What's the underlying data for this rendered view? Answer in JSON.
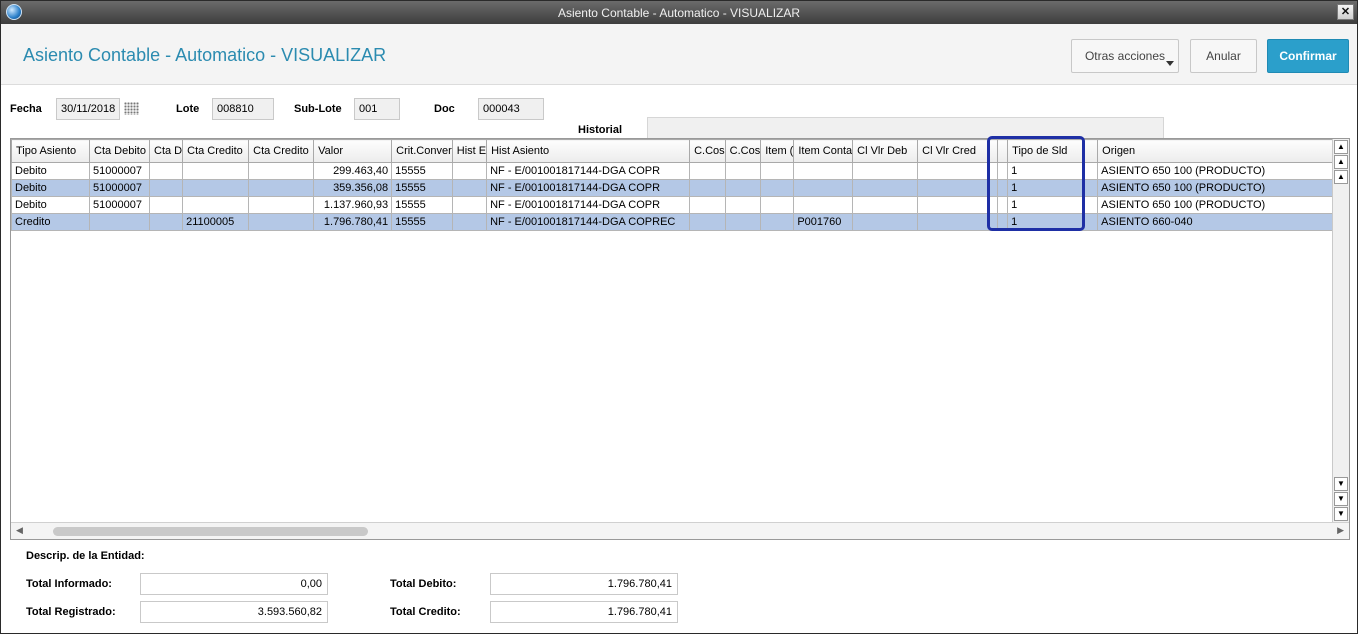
{
  "window": {
    "title": "Asiento Contable - Automatico - VISUALIZAR"
  },
  "header": {
    "page_title": "Asiento Contable - Automatico - VISUALIZAR",
    "otras_label": "Otras acciones",
    "anular_label": "Anular",
    "confirmar_label": "Confirmar"
  },
  "form": {
    "fecha_label": "Fecha",
    "fecha_value": "30/11/2018",
    "lote_label": "Lote",
    "lote_value": "008810",
    "sublote_label": "Sub-Lote",
    "sublote_value": "001",
    "doc_label": "Doc",
    "doc_value": "000043",
    "historial_label": "Historial"
  },
  "grid": {
    "columns": [
      "Tipo Asiento",
      "Cta Debito",
      "Cta D",
      "Cta Credito",
      "Cta Credito",
      "Valor",
      "Crit.Conver",
      "Hist E",
      "Hist Asiento",
      "C.Cos",
      "C.Cos",
      "Item (",
      "Item Conta",
      "Cl Vlr Deb",
      "Cl Vlr Cred",
      "",
      "Tipo de Sld",
      "Origen"
    ],
    "rows": [
      [
        "Debito",
        "51000007",
        "",
        "",
        "",
        "299.463,40",
        "15555",
        "",
        "NF - E/001001817144-DGA COPR",
        "",
        "",
        "",
        "",
        "",
        "",
        "",
        "1",
        "ASIENTO 650 100 (PRODUCTO)"
      ],
      [
        "Debito",
        "51000007",
        "",
        "",
        "",
        "359.356,08",
        "15555",
        "",
        "NF - E/001001817144-DGA COPR",
        "",
        "",
        "",
        "",
        "",
        "",
        "",
        "1",
        "ASIENTO 650 100 (PRODUCTO)"
      ],
      [
        "Debito",
        "51000007",
        "",
        "",
        "",
        "1.137.960,93",
        "15555",
        "",
        "NF - E/001001817144-DGA COPR",
        "",
        "",
        "",
        "",
        "",
        "",
        "",
        "1",
        "ASIENTO 650 100 (PRODUCTO)"
      ],
      [
        "Credito",
        "",
        "",
        "21100005",
        "",
        "1.796.780,41",
        "15555",
        "",
        "NF - E/001001817144-DGA COPREC",
        "",
        "",
        "",
        "P001760",
        "",
        "",
        "",
        "1",
        "ASIENTO 660-040"
      ]
    ],
    "selected_rows": [
      1,
      3
    ]
  },
  "footer": {
    "descrip_label": "Descrip. de la Entidad:",
    "total_informado_label": "Total Informado:",
    "total_informado_value": "0,00",
    "total_registrado_label": "Total Registrado:",
    "total_registrado_value": "3.593.560,82",
    "total_debito_label": "Total Debito:",
    "total_debito_value": "1.796.780,41",
    "total_credito_label": "Total Credito:",
    "total_credito_value": "1.796.780,41"
  },
  "icons": {
    "close": "close-icon",
    "calendar": "calendar-icon",
    "app": "app-globe-icon"
  },
  "colors": {
    "accent": "#2b9fcb",
    "title_text": "#2b8bb0",
    "row_selected": "#b4c8e6",
    "highlight_box": "#1e2fa5"
  }
}
